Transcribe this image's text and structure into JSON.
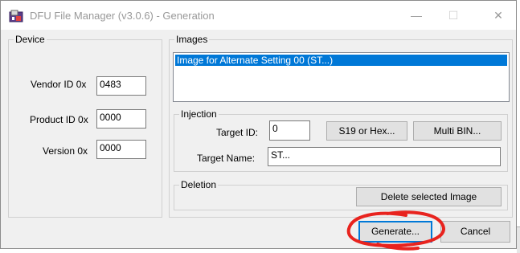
{
  "window": {
    "title": "DFU File Manager (v3.0.6) - Generation",
    "minimize_symbol": "—",
    "maximize_symbol": "☐",
    "close_symbol": "✕"
  },
  "device": {
    "group_label": "Device",
    "vendor_label": "Vendor ID 0x",
    "vendor_value": "0483",
    "product_label": "Product ID 0x",
    "product_value": "0000",
    "version_label": "Version 0x",
    "version_value": "0000"
  },
  "images": {
    "group_label": "Images",
    "items": [
      "Image for Alternate Setting 00  (ST...)"
    ]
  },
  "injection": {
    "group_label": "Injection",
    "target_id_label": "Target ID:",
    "target_id_value": "0",
    "s19_hex_button": "S19 or Hex...",
    "multi_bin_button": "Multi BIN...",
    "target_name_label": "Target Name:",
    "target_name_value": "ST..."
  },
  "deletion": {
    "group_label": "Deletion",
    "delete_button": "Delete selected Image"
  },
  "actions": {
    "generate_button": "Generate...",
    "cancel_button": "Cancel"
  },
  "colors": {
    "selection": "#0078d7",
    "annotation": "#e8231e"
  },
  "icons": {
    "app": "dfu-app-icon"
  }
}
